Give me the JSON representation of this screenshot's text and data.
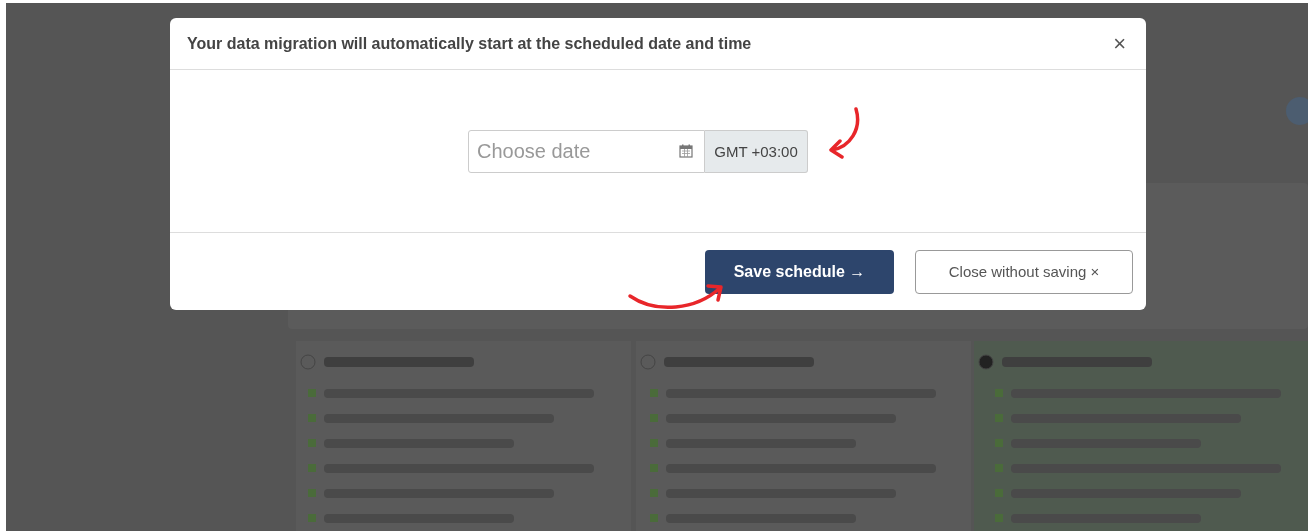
{
  "modal": {
    "title": "Your data migration will automatically start at the scheduled date and time",
    "close_glyph": "×",
    "date_field": {
      "placeholder": "Choose date"
    },
    "timezone": "GMT +03:00",
    "buttons": [
      {
        "label": "Save schedule →",
        "kind": "primary"
      },
      {
        "label": "Close without saving ×",
        "kind": "secondary"
      }
    ]
  }
}
